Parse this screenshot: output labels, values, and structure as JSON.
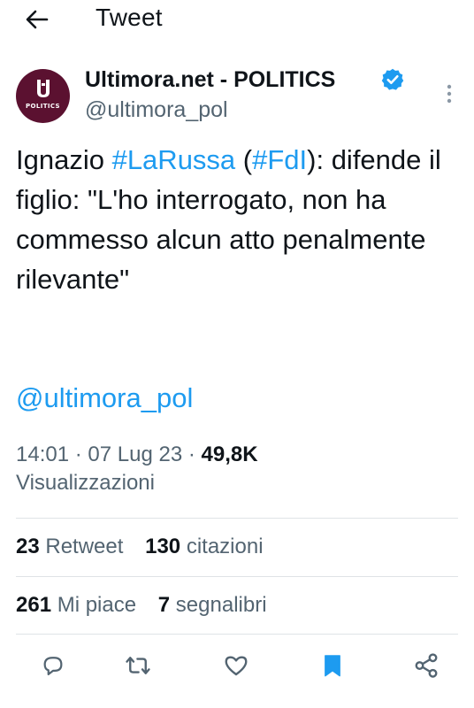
{
  "header": {
    "title": "Tweet"
  },
  "author": {
    "display_name": "Ultimora.net - POLITICS",
    "handle": "@ultimora_pol",
    "avatar_label": "POLITICS"
  },
  "tweet": {
    "text_part1": "Ignazio ",
    "hashtag1": "#LaRussa",
    "text_part2": " (",
    "hashtag2": "#FdI",
    "text_part3": "): difende il figlio: \"L'ho interrogato, non ha commesso alcun atto penalmente rilevante\"",
    "mention": "@ultimora_pol"
  },
  "meta": {
    "time": "14:01",
    "separator": "·",
    "date": "07 Lug 23",
    "views_count": "49,8K",
    "views_label": "Visualizzazioni"
  },
  "stats": {
    "retweets_count": "23",
    "retweets_label": "Retweet",
    "quotes_count": "130",
    "quotes_label": "citazioni",
    "likes_count": "261",
    "likes_label": "Mi piace",
    "bookmarks_count": "7",
    "bookmarks_label": "segnalibri"
  },
  "icons": {
    "back": "arrow-left-icon",
    "verified": "verified-badge-icon",
    "more": "more-vertical-icon",
    "reply": "reply-icon",
    "retweet": "retweet-icon",
    "like": "heart-icon",
    "bookmark": "bookmark-icon",
    "share": "share-icon"
  },
  "colors": {
    "accent": "#1d9bf0",
    "text": "#0f1419",
    "secondary": "#536471",
    "avatar_bg": "#5b1130"
  }
}
